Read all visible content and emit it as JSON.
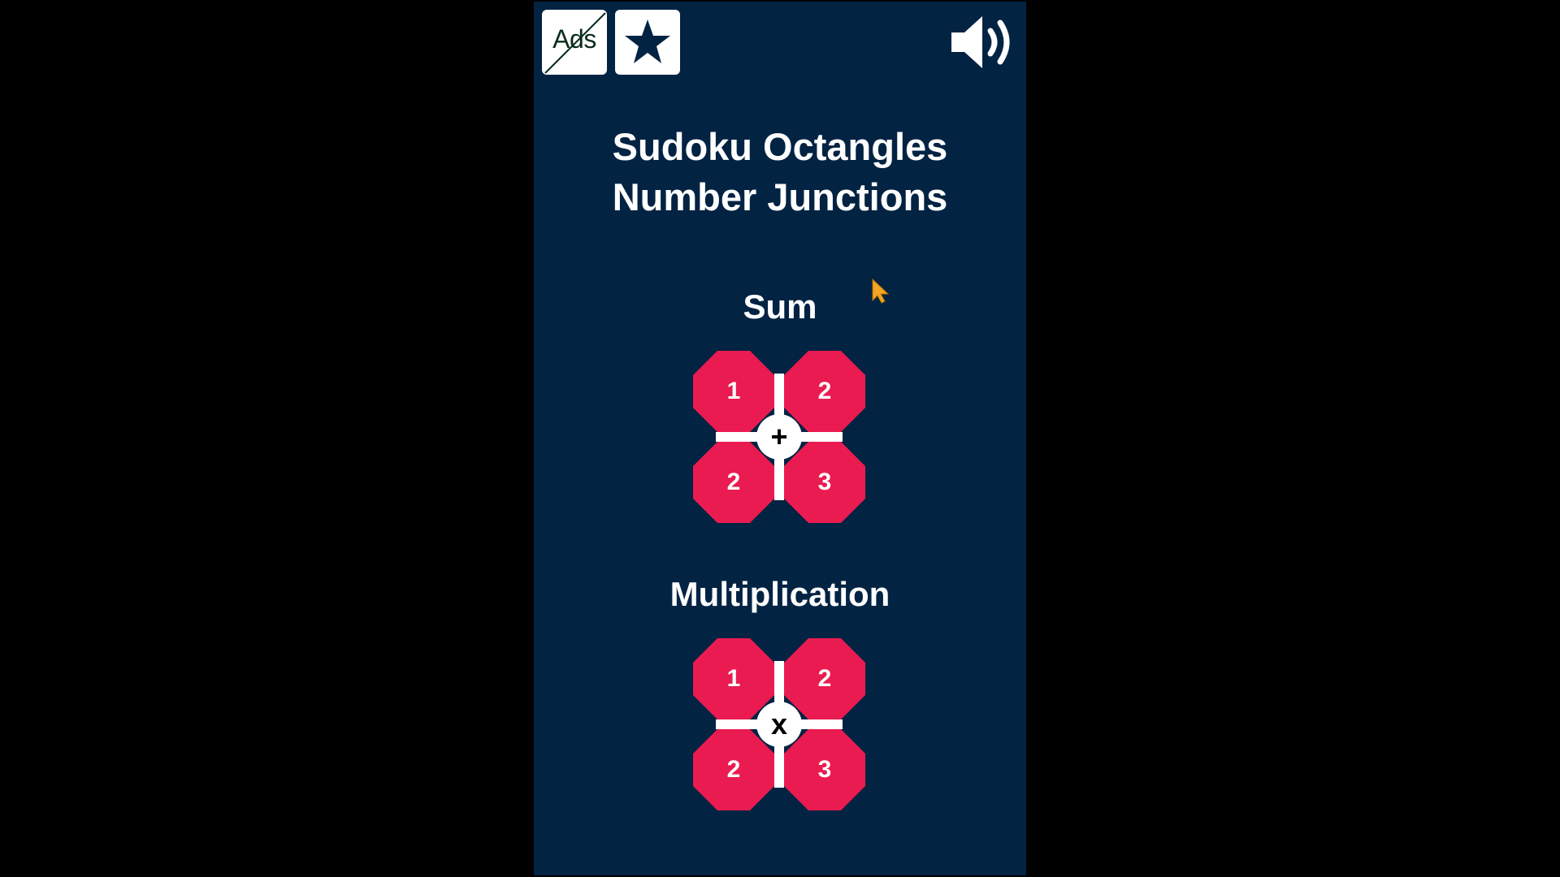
{
  "header": {
    "ads_button_label": "Ads",
    "rate_button_icon": "star-icon",
    "sound_button_icon": "speaker-volume-icon"
  },
  "title": {
    "line1": "Sudoku Octangles",
    "line2": "Number Junctions"
  },
  "sections": [
    {
      "label": "Sum",
      "operator": "+",
      "cells": {
        "top_left": "1",
        "top_right": "2",
        "bottom_left": "2",
        "bottom_right": "3"
      }
    },
    {
      "label": "Multiplication",
      "operator": "x",
      "cells": {
        "top_left": "1",
        "top_right": "2",
        "bottom_left": "2",
        "bottom_right": "3"
      }
    }
  ],
  "colors": {
    "background": "#032343",
    "tile": "#ea1b50",
    "text": "#ffffff",
    "frame": "#000000"
  }
}
